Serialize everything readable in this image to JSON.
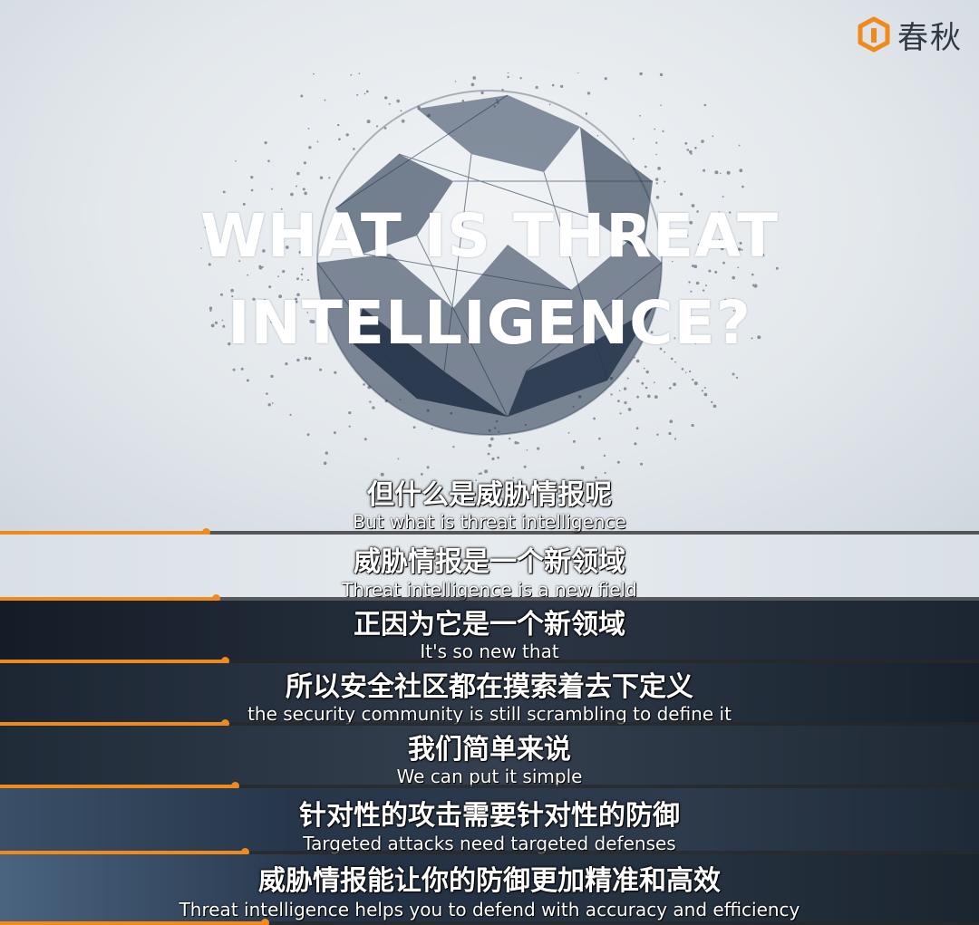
{
  "brand": {
    "name": "春秋",
    "logo_icon": "chunqiu-logo-icon",
    "accent": "#f08a1c"
  },
  "hero": {
    "title_line1": "WHAT IS THREAT",
    "title_line2": "INTELLIGENCE?"
  },
  "subtitles": [
    {
      "zh": "但什么是威胁情报呢",
      "en": "But what is threat intelligence",
      "progress": 0.21
    },
    {
      "zh": "威胁情报是一个新领域",
      "en": "Threat intelligence is a new field",
      "progress": 0.22
    },
    {
      "zh": "正因为它是一个新领域",
      "en": "It's so new that",
      "progress": 0.23
    },
    {
      "zh": "所以安全社区都在摸索着去下定义",
      "en": "the security community is still scrambling to define it",
      "progress": 0.23
    },
    {
      "zh": "我们简单来说",
      "en": "We can put it simple",
      "progress": 0.24
    },
    {
      "zh": "针对性的攻击需要针对性的防御",
      "en": "Targeted attacks need targeted defenses",
      "progress": 0.25
    },
    {
      "zh": "威胁情报能让你的防御更加精准和高效",
      "en": "Threat intelligence helps you to defend with accuracy and efficiency",
      "progress": 0.27
    }
  ]
}
